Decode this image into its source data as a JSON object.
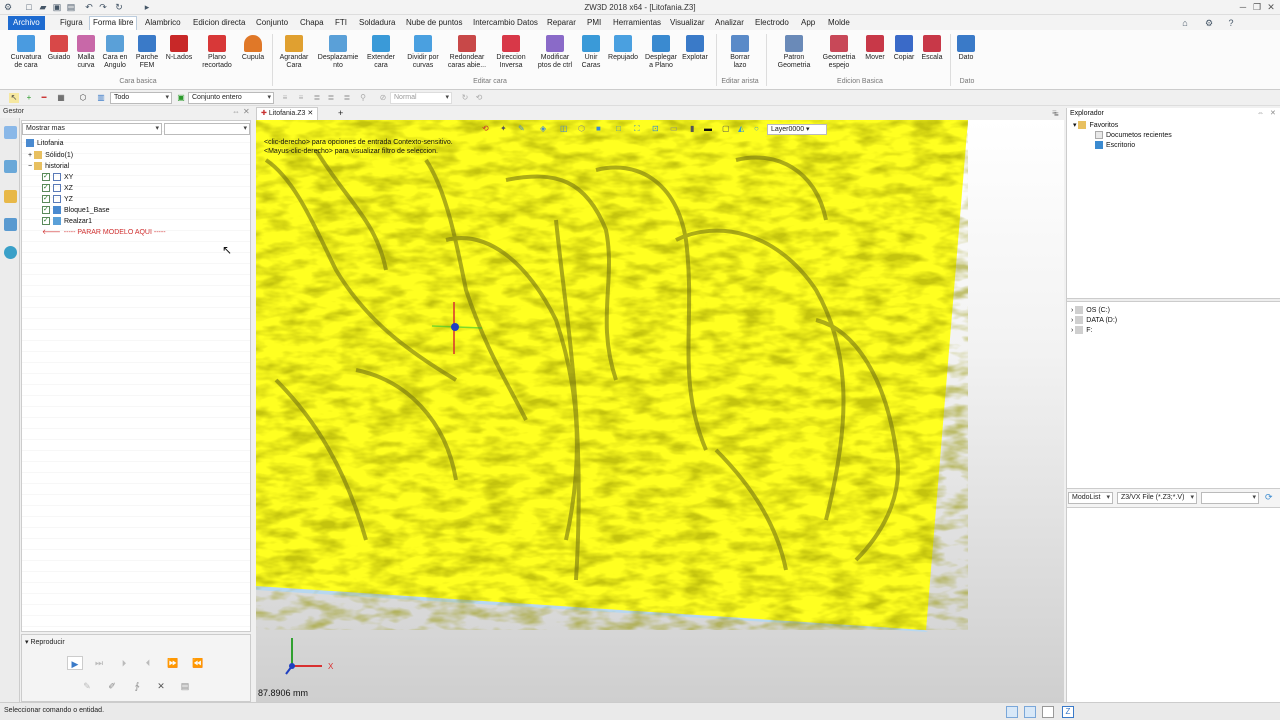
{
  "window": {
    "title": "ZW3D 2018 x64 - [Litofania.Z3]"
  },
  "menu": {
    "tabs": [
      "Archivo",
      "Figura",
      "Forma libre",
      "Alambrico",
      "Edicion directa",
      "Conjunto",
      "Chapa",
      "FTI",
      "Soldadura",
      "Nube de puntos",
      "Intercambio Datos",
      "Reparar",
      "PMI",
      "Herramientas",
      "Visualizar",
      "Analizar",
      "Electrodo",
      "App",
      "Molde"
    ],
    "active": "Forma libre"
  },
  "ribbon": {
    "buttons": [
      "Curvatura\nde cara",
      "Guiado",
      "Malla\ncurva",
      "Cara en\nAngulo",
      "Parche\nFEM",
      "N-Lados",
      "Plano\nrecortado",
      "Cupula",
      "Agrandar\nCara",
      "Desplazamie\nnto",
      "Extender\ncara",
      "Dividir por\ncurvas",
      "Redondear\ncaras abie...",
      "Direccion\nInversa",
      "Modificar\nptos de ctrl",
      "Unir\nCaras",
      "Repujado",
      "Desplegar\na Plano",
      "Explotar",
      "Borrar\nlazo",
      "Patron\nGeometria",
      "Geometria\nespejo",
      "Mover",
      "Copiar",
      "Escala",
      "Dato"
    ],
    "groups": [
      "Cara basica",
      "Editar cara",
      "Editar arista",
      "Edicion Basica",
      "Dato"
    ]
  },
  "toolbar": {
    "filter": "Todo",
    "selection": "Conjunto entero",
    "render": "Normal"
  },
  "gestor": {
    "title": "Gestor",
    "show": "Mostrar mas"
  },
  "tree": {
    "root": "Litofania",
    "items": [
      "Sólido(1)",
      "historial",
      "XY",
      "XZ",
      "YZ",
      "Bloque1_Base",
      "Realzar1",
      "----- PARAR MODELO AQUI -----"
    ]
  },
  "repro": {
    "title": "Reproducir"
  },
  "viewport": {
    "tab": "Litofania.Z3",
    "hint1": "<clic-derecho> para opciones de entrada Contexto-sensitivo.",
    "hint2": "<Mayus-clic-derecho> para visualizar filtro de seleccion.",
    "layer": "Layer0000",
    "measure": "87.8906 mm",
    "axis_x": "X"
  },
  "explorer": {
    "title": "Explorador",
    "favorites": "Favoritos",
    "recent": "Documetos recientes",
    "desktop": "Escritorio",
    "drives": [
      "OS (C:)",
      "DATA (D:)",
      "F:"
    ],
    "mode": "ModoList",
    "filetype": "Z3/VX File (*.Z3;*.V)"
  },
  "status": {
    "text": "Seleccionar comando o entidad."
  },
  "colors": {
    "accent": "#1e6bd0",
    "model": "#ffff20"
  }
}
